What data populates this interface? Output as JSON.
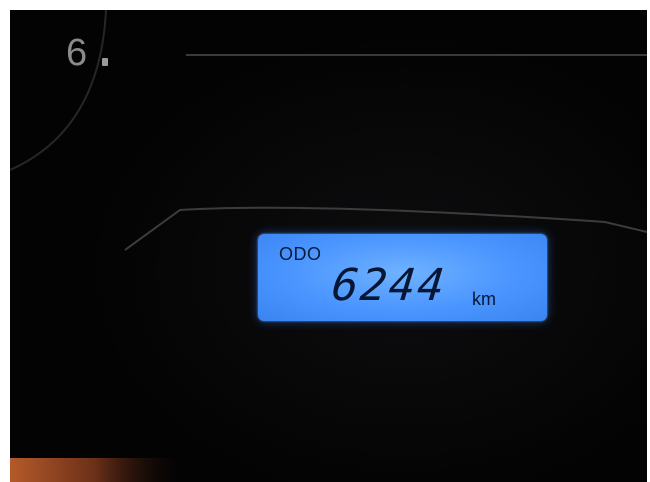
{
  "gauge": {
    "number": "6"
  },
  "odometer": {
    "label": "ODO",
    "value": "6244",
    "unit": "km"
  }
}
